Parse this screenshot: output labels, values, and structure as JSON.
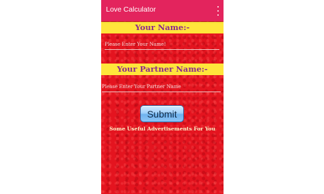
{
  "app_bar": {
    "title": "Love Calculator",
    "overflow_icon": "more-vert-icon",
    "background": "#e3245d"
  },
  "form": {
    "name_heading": "Your Name:-",
    "name_placeholder": "Please Enter Your Name!",
    "name_value": "",
    "partner_heading": "Your Partner Name:-",
    "partner_placeholder": "Please Enter Your Partner Name",
    "partner_value": "",
    "submit_label": "Submit"
  },
  "footer": {
    "ads_text": "Some Useful Advertisements For You"
  },
  "colors": {
    "background": "#e4141f",
    "banner": "#ffe53b",
    "banner_text": "#8c2a8c",
    "button": "#9fd0fb"
  }
}
